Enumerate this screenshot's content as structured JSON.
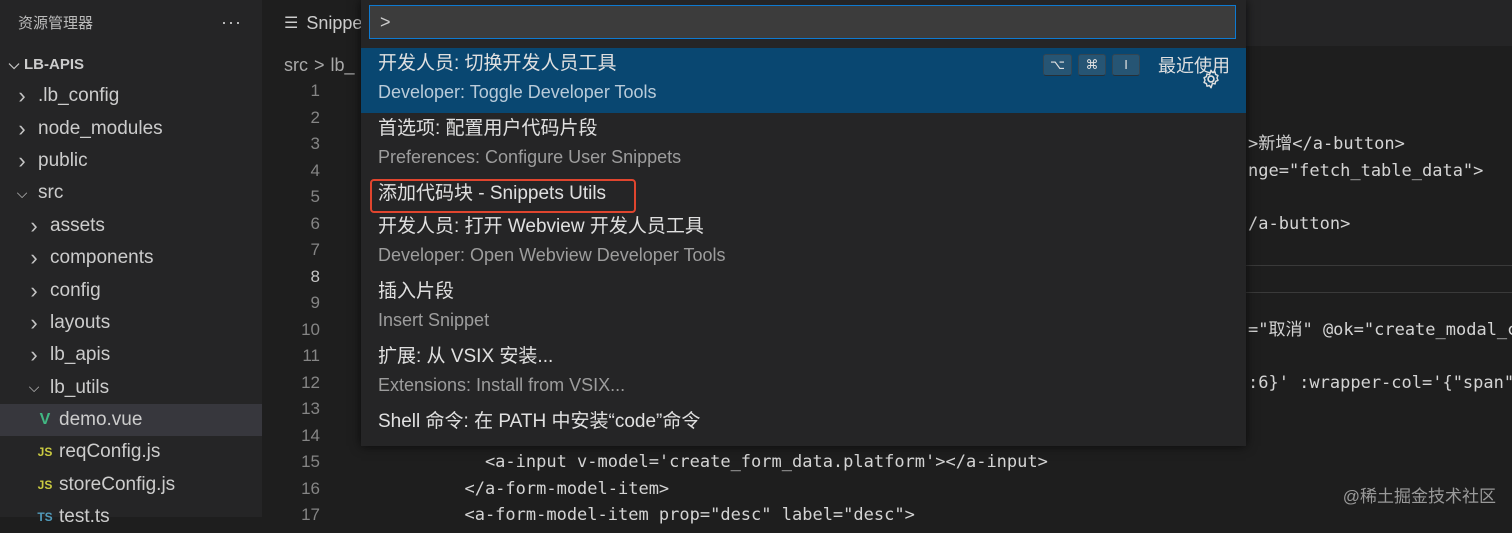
{
  "sidebar": {
    "title": "资源管理器",
    "more": "···",
    "project": "LB-APIS",
    "items": [
      {
        "label": ".lb_config",
        "level": 0,
        "type": "folder",
        "open": false
      },
      {
        "label": "node_modules",
        "level": 0,
        "type": "folder",
        "open": false
      },
      {
        "label": "public",
        "level": 0,
        "type": "folder",
        "open": false
      },
      {
        "label": "src",
        "level": 0,
        "type": "folder",
        "open": true
      },
      {
        "label": "assets",
        "level": 1,
        "type": "folder",
        "open": false
      },
      {
        "label": "components",
        "level": 1,
        "type": "folder",
        "open": false
      },
      {
        "label": "config",
        "level": 1,
        "type": "folder",
        "open": false
      },
      {
        "label": "layouts",
        "level": 1,
        "type": "folder",
        "open": false
      },
      {
        "label": "lb_apis",
        "level": 1,
        "type": "folder",
        "open": false
      },
      {
        "label": "lb_utils",
        "level": 1,
        "type": "folder",
        "open": true
      },
      {
        "label": "demo.vue",
        "level": 2,
        "type": "vue",
        "active": true
      },
      {
        "label": "reqConfig.js",
        "level": 2,
        "type": "js"
      },
      {
        "label": "storeConfig.js",
        "level": 2,
        "type": "js"
      },
      {
        "label": "test.ts",
        "level": 2,
        "type": "ts"
      }
    ]
  },
  "tab": {
    "label": "Snippe"
  },
  "breadcrumb": {
    "part1": "src",
    "sep": ">",
    "part2": "lb_"
  },
  "editor": {
    "line_numbers": [
      "1",
      "2",
      "3",
      "4",
      "5",
      "6",
      "7",
      "8",
      "9",
      "10",
      "11",
      "12",
      "13",
      "14",
      "15",
      "16",
      "17"
    ],
    "current_line": "8",
    "visible_fragments": [
      {
        "line": 1,
        "text": "`"
      },
      {
        "line": 3,
        "text": ">新增</a-button>"
      },
      {
        "line": 4,
        "text": "nge=\"fetch_table_data\">"
      },
      {
        "line": 6,
        "text": "/a-button>"
      },
      {
        "line": 10,
        "text": "=\"取消\" @ok=\"create_modal_c"
      },
      {
        "line": 12,
        "text": ":6}' :wrapper-col='{\"span\""
      },
      {
        "line": 15,
        "text": "    <a-input v-model='create_form_data.platform'></a-input>"
      },
      {
        "line": 16,
        "text": "  </a-form-model-item>"
      },
      {
        "line": 17,
        "text": "  <a-form-model-item prop=\"desc\" label=\"desc\">"
      }
    ]
  },
  "palette": {
    "input_value": ">",
    "commands": [
      {
        "label": "开发人员: 切换开发人员工具",
        "detail": "Developer: Toggle Developer Tools",
        "keys": [
          "⌥",
          "⌘",
          "I"
        ],
        "tag": "最近使用",
        "selected": true
      },
      {
        "label": "首选项: 配置用户代码片段",
        "detail": "Preferences: Configure User Snippets"
      },
      {
        "label": "添加代码块 - Snippets Utils",
        "detail": "",
        "highlighted": true
      },
      {
        "label": "开发人员: 打开 Webview 开发人员工具",
        "detail": "Developer: Open Webview Developer Tools"
      },
      {
        "label": "插入片段",
        "detail": "Insert Snippet"
      },
      {
        "label": "扩展: 从 VSIX 安装...",
        "detail": "Extensions: Install from VSIX..."
      },
      {
        "label": "Shell 命令: 在 PATH 中安装“code”命令",
        "detail": ""
      }
    ]
  },
  "watermark": "@稀土掘金技术社区",
  "colors": {
    "selection": "#094771",
    "focus_border": "#0e7ad1",
    "annotation_red": "#e0452e",
    "vue_green": "#41b883"
  }
}
